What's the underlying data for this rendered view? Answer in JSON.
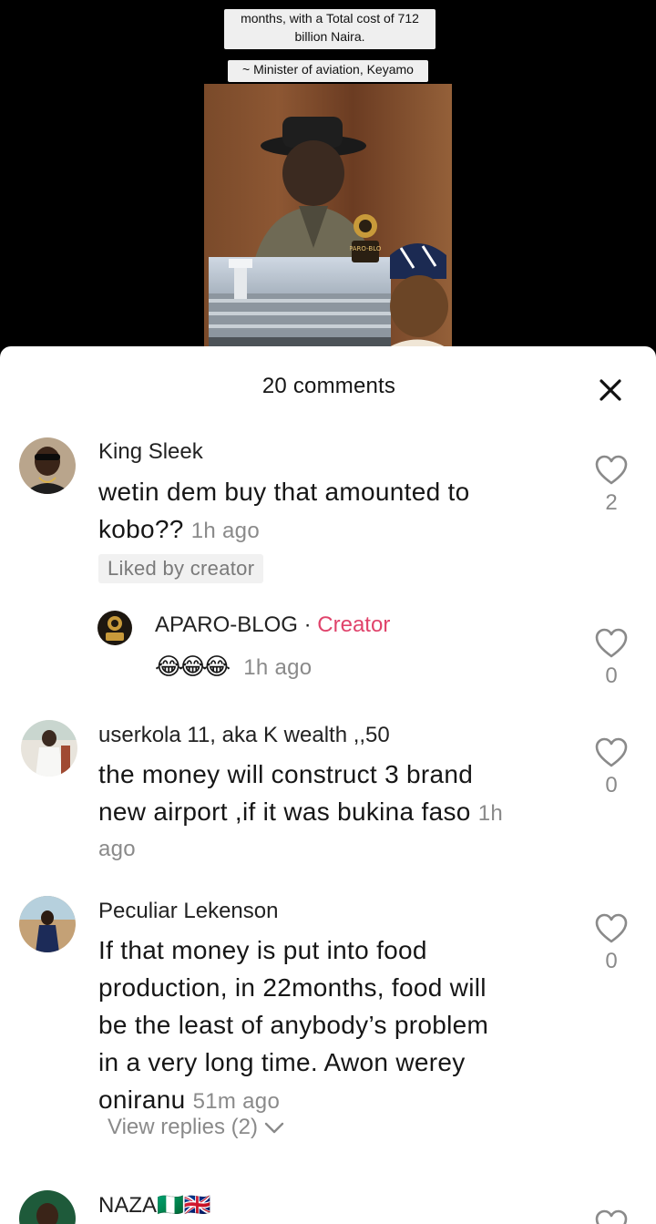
{
  "video": {
    "caption_line1": "months, with a Total cost of 712",
    "caption_line2": "billion Naira.",
    "caption_attribution": "~ Minister of aviation, Keyamo",
    "thumb_logo_text": "APARO-BLOG"
  },
  "comments_panel": {
    "title": "20 comments",
    "close_icon": "close-icon"
  },
  "comments": [
    {
      "username": "King Sleek",
      "text": "wetin dem buy that amounted to kobo??",
      "time": "1h ago",
      "badge": "Liked by creator",
      "likes": "2"
    },
    {
      "username": "APARO-BLOG",
      "separator": "·",
      "creator_label": "Creator",
      "text": "😂😂😂",
      "time": "1h ago",
      "likes": "0"
    },
    {
      "username": "userkola 11, aka K wealth ,,50",
      "text_line1": "the money will construct 3 brand",
      "text_line2": "new airport ,if it was bukina faso",
      "time_part1": "1h",
      "time_part2": "ago",
      "likes": "0"
    },
    {
      "username": "Peculiar Lekenson",
      "text_lines": [
        "If that money is put into food",
        "production, in 22months, food will",
        "be the least of anybody’s problem",
        "in a very long time. Awon werey"
      ],
      "text_last": "oniranu",
      "time": "51m ago",
      "view_replies": "View replies (2)",
      "likes": "0"
    },
    {
      "username": "NAZA🇳🇬🇬🇧"
    }
  ],
  "colors": {
    "creator_accent": "#e0436b",
    "muted": "#8a8a8a",
    "sheet_bg": "#ffffff"
  }
}
